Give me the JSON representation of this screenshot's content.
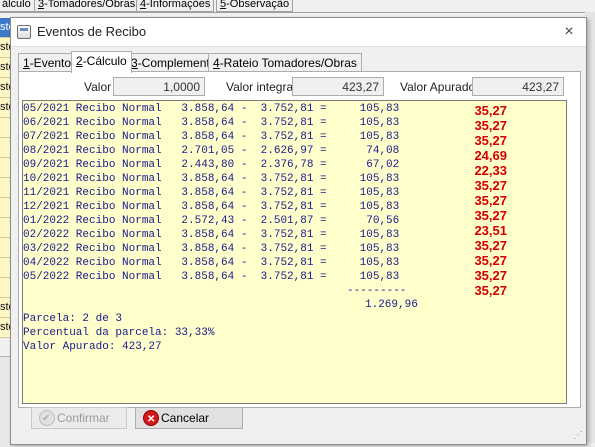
{
  "background": {
    "tabs": [
      {
        "acc": "",
        "label": "álculo"
      },
      {
        "acc": "3",
        "label": "-Tomadores/Obras"
      },
      {
        "acc": "4",
        "label": "-Informações"
      },
      {
        "acc": "5",
        "label": "-Observação"
      }
    ],
    "grid_cells": [
      "ste",
      "ste",
      "ste",
      "ste",
      "ste",
      "",
      "",
      "",
      "",
      "",
      "",
      "",
      "",
      "",
      "ste",
      "ste"
    ]
  },
  "dialog": {
    "title": "Eventos de Recibo",
    "close_glyph": "×",
    "tabs": [
      {
        "acc": "1",
        "label": "-Evento"
      },
      {
        "acc": "2",
        "label": "-Cálculo"
      },
      {
        "acc": "3",
        "label": "-Complemento"
      },
      {
        "acc": "4",
        "label": "-Rateio Tomadores/Obras"
      }
    ],
    "active_tab": "2-Cálculo",
    "fields": {
      "valor_label": "Valor",
      "valor_value": "1,0000",
      "valor_integral_label": "Valor integral",
      "valor_integral_value": "423,27",
      "valor_apurado_label": "Valor Apurado",
      "valor_apurado_value": "423,27"
    },
    "calc_rows": [
      {
        "text": "05/2021 Recibo Normal   3.858,64 -  3.752,81 =     105,83",
        "result": "35,27"
      },
      {
        "text": "06/2021 Recibo Normal   3.858,64 -  3.752,81 =     105,83",
        "result": "35,27"
      },
      {
        "text": "07/2021 Recibo Normal   3.858,64 -  3.752,81 =     105,83",
        "result": "35,27"
      },
      {
        "text": "08/2021 Recibo Normal   2.701,05 -  2.626,97 =      74,08",
        "result": "24,69"
      },
      {
        "text": "09/2021 Recibo Normal   2.443,80 -  2.376,78 =      67,02",
        "result": "22,33"
      },
      {
        "text": "10/2021 Recibo Normal   3.858,64 -  3.752,81 =     105,83",
        "result": "35,27"
      },
      {
        "text": "11/2021 Recibo Normal   3.858,64 -  3.752,81 =     105,83",
        "result": "35,27"
      },
      {
        "text": "12/2021 Recibo Normal   3.858,64 -  3.752,81 =     105,83",
        "result": "35,27"
      },
      {
        "text": "01/2022 Recibo Normal   2.572,43 -  2.501,87 =      70,56",
        "result": "23,51"
      },
      {
        "text": "02/2022 Recibo Normal   3.858,64 -  3.752,81 =     105,83",
        "result": "35,27"
      },
      {
        "text": "03/2022 Recibo Normal   3.858,64 -  3.752,81 =     105,83",
        "result": "35,27"
      },
      {
        "text": "04/2022 Recibo Normal   3.858,64 -  3.752,81 =     105,83",
        "result": "35,27"
      },
      {
        "text": "05/2022 Recibo Normal   3.858,64 -  3.752,81 =     105,83",
        "result": "35,27"
      }
    ],
    "separator": "---------",
    "total": "1.269,96",
    "summary": {
      "parcela": "Parcela: 2 de 3",
      "percentual": "Percentual da parcela: 33,33%",
      "valor_apurado": "Valor Apurado: 423,27"
    },
    "buttons": {
      "confirm": "Confirmar",
      "cancel": "Cancelar"
    },
    "colors": {
      "list_background": "#ffffcc",
      "list_text": "#1a1a8c",
      "result_text": "#d40000"
    }
  }
}
